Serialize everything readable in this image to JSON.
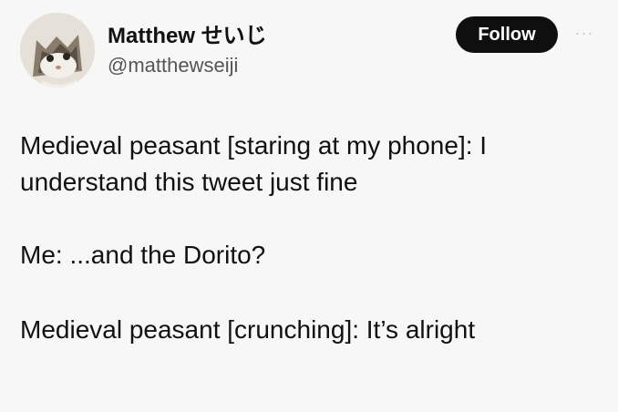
{
  "author": {
    "display_name": "Matthew せいじ",
    "handle": "@matthewseiji",
    "avatar_icon": "cat-avatar-icon"
  },
  "actions": {
    "follow_label": "Follow",
    "more_label": "···"
  },
  "tweet": {
    "paragraphs": [
      "Medieval peasant [staring at my phone]: I understand this tweet just fine",
      "Me: ...and the Dorito?",
      "Medieval peasant [crunching]: It’s alright"
    ]
  },
  "colors": {
    "background": "#f7f7f7",
    "follow_button": "#0f0f0f",
    "text": "#111111",
    "handle": "#555555"
  }
}
